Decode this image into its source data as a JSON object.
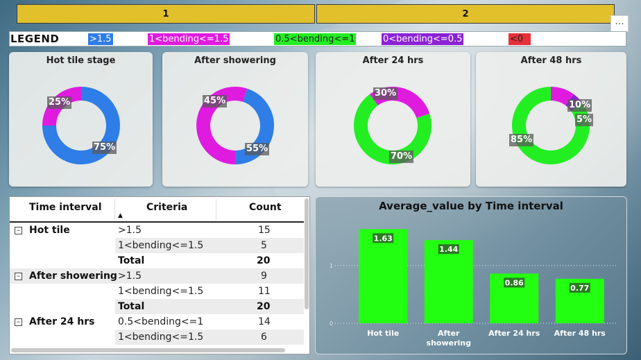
{
  "tabs": [
    "1",
    "2"
  ],
  "more_label": "...",
  "legend": {
    "title": "LEGEND",
    "items": [
      {
        "label": ">1.5",
        "color": "#2f7de6"
      },
      {
        "label": "1<bending<=1.5",
        "color": "#e01be0"
      },
      {
        "label": "0.5<bending<=1",
        "color": "#22ee22"
      },
      {
        "label": "0<bending<=0.5",
        "color": "#8c22d6"
      },
      {
        "label": "<0",
        "color": "#e8303a"
      }
    ]
  },
  "donuts": [
    {
      "title": "Hot tile stage",
      "slices": [
        {
          "label": "75%",
          "value": 75,
          "color": "#2f7de6"
        },
        {
          "label": "25%",
          "value": 25,
          "color": "#e01be0"
        }
      ]
    },
    {
      "title": "After showering",
      "slices": [
        {
          "label": "55%",
          "value": 55,
          "color": "#e01be0"
        },
        {
          "label": "45%",
          "value": 45,
          "color": "#2f7de6"
        }
      ]
    },
    {
      "title": "After 24 hrs",
      "slices": [
        {
          "label": "70%",
          "value": 70,
          "color": "#22ee22"
        },
        {
          "label": "30%",
          "value": 30,
          "color": "#e01be0"
        }
      ]
    },
    {
      "title": "After 48 hrs",
      "slices": [
        {
          "label": "85%",
          "value": 85,
          "color": "#22ee22"
        },
        {
          "label": "10%",
          "value": 10,
          "color": "#e01be0"
        },
        {
          "label": "5%",
          "value": 5,
          "color": "#8c22d6"
        }
      ]
    }
  ],
  "table": {
    "headers": [
      "Time interval",
      "Criteria",
      "Count"
    ],
    "groups": [
      {
        "name": "Hot tile",
        "rows": [
          {
            "criteria": ">1.5",
            "count": "15"
          },
          {
            "criteria": "1<bending<=1.5",
            "count": "5"
          }
        ],
        "total_label": "Total",
        "total": "20"
      },
      {
        "name": "After showering",
        "rows": [
          {
            "criteria": ">1.5",
            "count": "9"
          },
          {
            "criteria": "1<bending<=1.5",
            "count": "11"
          }
        ],
        "total_label": "Total",
        "total": "20"
      },
      {
        "name": "After 24 hrs",
        "rows": [
          {
            "criteria": "0.5<bending<=1",
            "count": "14"
          },
          {
            "criteria": "1<bending<=1.5",
            "count": "6"
          }
        ]
      }
    ]
  },
  "chart_data": {
    "type": "bar",
    "title": "Average_value by Time interval",
    "categories": [
      "Hot tile",
      "After showering",
      "After 24 hrs",
      "After 48 hrs"
    ],
    "values": [
      1.63,
      1.44,
      0.86,
      0.77
    ],
    "data_labels": [
      "1.63",
      "1.44",
      "0.86",
      "0.77"
    ],
    "ylim": [
      0,
      1.85
    ],
    "yticks": [
      {
        "value": 0,
        "label": "0"
      },
      {
        "value": 1,
        "label": "1"
      }
    ],
    "bar_color": "#22ff11",
    "grid": true
  }
}
